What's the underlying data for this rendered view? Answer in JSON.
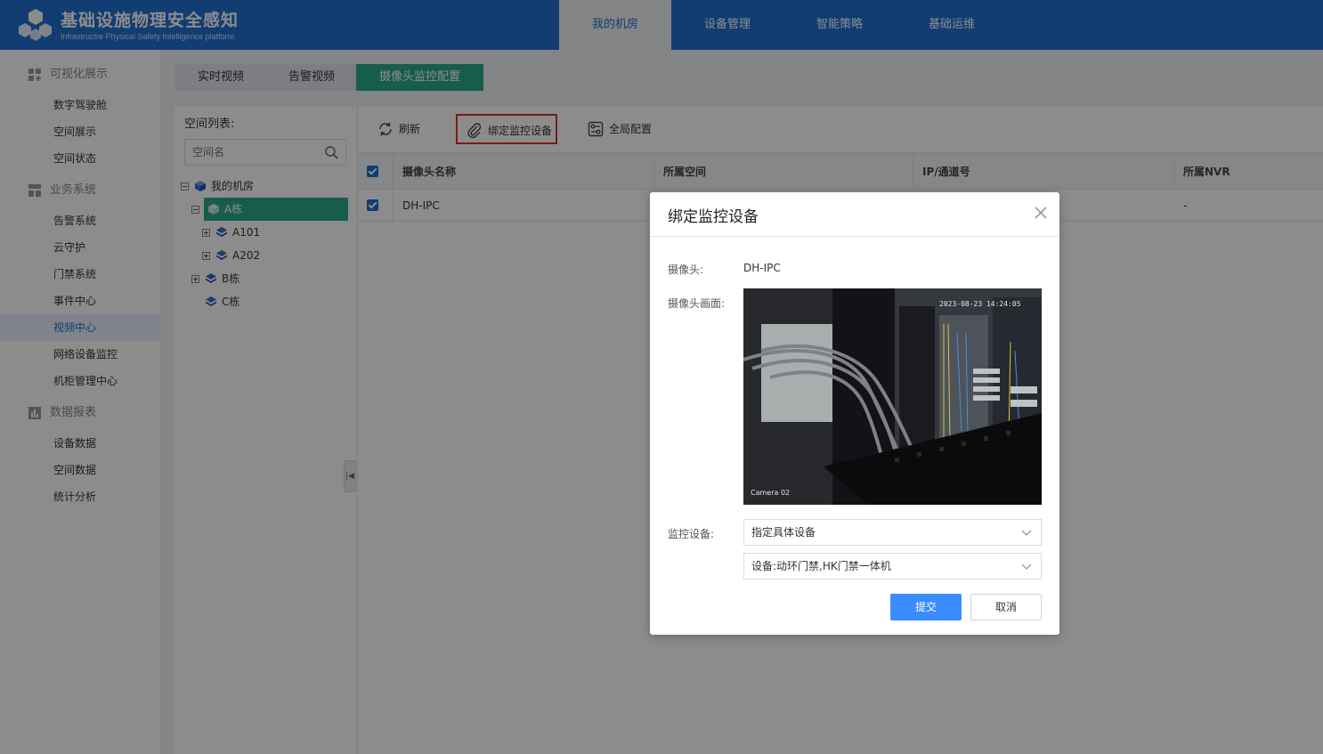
{
  "header": {
    "title": "基础设施物理安全感知",
    "subtitle": "Infrastructre Physical Safety Intelligence platform",
    "nav": [
      "我的机房",
      "设备管理",
      "智能策略",
      "基础运维"
    ],
    "active_nav": "我的机房"
  },
  "sidebar": {
    "groups": [
      {
        "label": "可视化展示",
        "items": [
          "数字驾驶舱",
          "空间展示",
          "空间状态"
        ]
      },
      {
        "label": "业务系统",
        "items": [
          "告警系统",
          "云守护",
          "门禁系统",
          "事件中心",
          "视频中心",
          "网络设备监控",
          "机柜管理中心"
        ]
      },
      {
        "label": "数据报表",
        "items": [
          "设备数据",
          "空间数据",
          "统计分析"
        ]
      }
    ],
    "active_item": "视频中心"
  },
  "tabs": [
    "实时视频",
    "告警视频",
    "摄像头监控配置"
  ],
  "tree": {
    "title": "空间列表:",
    "search_placeholder": "空间名",
    "nodes": [
      {
        "label": "我的机房"
      },
      {
        "label": "A栋"
      },
      {
        "label": "A101"
      },
      {
        "label": "A202"
      },
      {
        "label": "B栋"
      },
      {
        "label": "C栋"
      }
    ]
  },
  "toolbar": {
    "refresh": "刷新",
    "bind": "绑定监控设备",
    "global": "全局配置"
  },
  "table": {
    "columns": [
      "摄像头名称",
      "所属空间",
      "IP/通道号",
      "所属NVR"
    ],
    "rows": [
      {
        "name": "DH-IPC",
        "space": "",
        "ip": "",
        "nvr": "-"
      }
    ]
  },
  "modal": {
    "title": "绑定监控设备",
    "camera_label": "摄像头:",
    "camera_value": "DH-IPC",
    "preview_label": "摄像头画面:",
    "preview_timestamp": "2023-08-23 14:24:05",
    "preview_caption": "Camera 02",
    "device_label": "监控设备:",
    "select_mode": "指定具体设备",
    "select_device": "设备:动环门禁,HK门禁一体机",
    "submit": "提交",
    "cancel": "取消"
  },
  "colors": {
    "brand": "#1f6fd1",
    "accent_green": "#2aaa8a",
    "primary_button": "#3b8cff",
    "highlight_border": "#e03030"
  }
}
